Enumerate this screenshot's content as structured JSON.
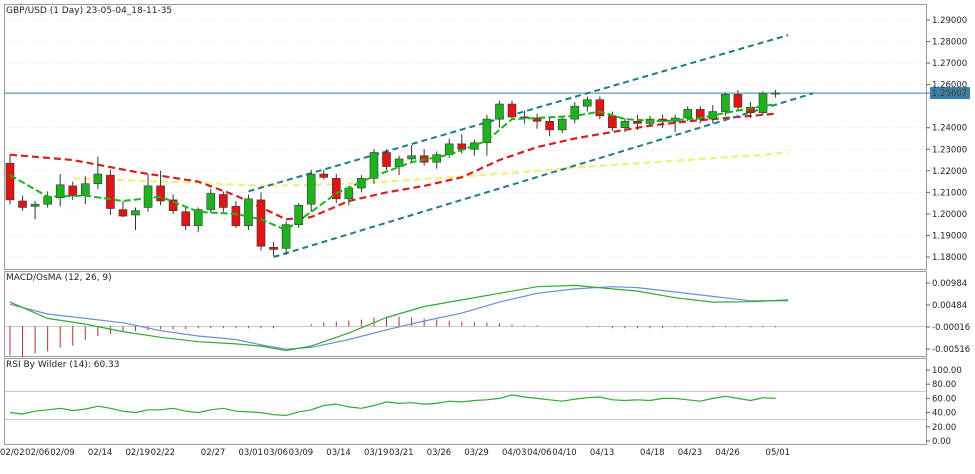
{
  "header": {
    "title": "GBP/USD (1 Day) 23-05-04_18-11-35",
    "macd_label": "MACD/OsMA (12, 26, 9)",
    "rsi_label": "RSI By Wilder (14): 60.33"
  },
  "colors": {
    "bull": "#1fb11f",
    "bear": "#e01515",
    "ma_fast": "#17b717",
    "ma_slow": "#d42020",
    "ma_long": "#f0f080",
    "channel": "#1e7c8a",
    "price_line": "#3a7fa8",
    "macd": "#6b8fd4",
    "signal": "#31a831",
    "osma": "#b03030",
    "rsi": "#31a831",
    "grid": "#c8c8c8"
  },
  "chart_data": [
    {
      "type": "candlestick",
      "title": "GBP/USD (1 Day) 23-05-04_18-11-35",
      "yticks": [
        "1.29000",
        "1.28000",
        "1.27000",
        "1.26000",
        "1.25607",
        "1.24000",
        "1.23000",
        "1.22000",
        "1.21000",
        "1.20000",
        "1.19000",
        "1.18000"
      ],
      "ylim": [
        1.175,
        1.292
      ],
      "current_price": 1.25607,
      "xticks": [
        "02/02",
        "02/06",
        "02/09",
        "02/14",
        "02/19",
        "02/22",
        "02/27",
        "03/01",
        "03/06",
        "03/09",
        "03/14",
        "03/19",
        "03/21",
        "03/26",
        "03/29",
        "04/03",
        "04/06",
        "04/10",
        "04/13",
        "04/18",
        "04/23",
        "04/26",
        "05/01"
      ],
      "candles": [
        {
          "o": 1.2235,
          "h": 1.2275,
          "l": 1.2045,
          "c": 1.2065
        },
        {
          "o": 1.206,
          "h": 1.2085,
          "l": 1.2015,
          "c": 1.203
        },
        {
          "o": 1.2035,
          "h": 1.206,
          "l": 1.1975,
          "c": 1.2045
        },
        {
          "o": 1.2045,
          "h": 1.2105,
          "l": 1.203,
          "c": 1.208
        },
        {
          "o": 1.2075,
          "h": 1.2185,
          "l": 1.2035,
          "c": 1.2135
        },
        {
          "o": 1.213,
          "h": 1.215,
          "l": 1.2065,
          "c": 1.2085
        },
        {
          "o": 1.2085,
          "h": 1.2175,
          "l": 1.2045,
          "c": 1.214
        },
        {
          "o": 1.214,
          "h": 1.2265,
          "l": 1.2115,
          "c": 1.2185
        },
        {
          "o": 1.218,
          "h": 1.2205,
          "l": 1.1995,
          "c": 1.2025
        },
        {
          "o": 1.202,
          "h": 1.206,
          "l": 1.1985,
          "c": 1.199
        },
        {
          "o": 1.1995,
          "h": 1.203,
          "l": 1.1925,
          "c": 1.2015
        },
        {
          "o": 1.203,
          "h": 1.2185,
          "l": 1.201,
          "c": 1.213
        },
        {
          "o": 1.213,
          "h": 1.22,
          "l": 1.204,
          "c": 1.206
        },
        {
          "o": 1.2065,
          "h": 1.209,
          "l": 1.2,
          "c": 1.2015
        },
        {
          "o": 1.201,
          "h": 1.203,
          "l": 1.1925,
          "c": 1.1945
        },
        {
          "o": 1.1945,
          "h": 1.203,
          "l": 1.1915,
          "c": 1.202
        },
        {
          "o": 1.202,
          "h": 1.2115,
          "l": 1.2005,
          "c": 1.2095
        },
        {
          "o": 1.209,
          "h": 1.2105,
          "l": 1.201,
          "c": 1.203
        },
        {
          "o": 1.2035,
          "h": 1.206,
          "l": 1.1935,
          "c": 1.1945
        },
        {
          "o": 1.1945,
          "h": 1.209,
          "l": 1.1925,
          "c": 1.207
        },
        {
          "o": 1.2065,
          "h": 1.21,
          "l": 1.183,
          "c": 1.185
        },
        {
          "o": 1.1845,
          "h": 1.187,
          "l": 1.1805,
          "c": 1.1835
        },
        {
          "o": 1.184,
          "h": 1.1965,
          "l": 1.181,
          "c": 1.195
        },
        {
          "o": 1.195,
          "h": 1.205,
          "l": 1.1935,
          "c": 1.204
        },
        {
          "o": 1.2045,
          "h": 1.2205,
          "l": 1.201,
          "c": 1.2185
        },
        {
          "o": 1.2185,
          "h": 1.2205,
          "l": 1.216,
          "c": 1.217
        },
        {
          "o": 1.2165,
          "h": 1.2185,
          "l": 1.205,
          "c": 1.207
        },
        {
          "o": 1.207,
          "h": 1.213,
          "l": 1.204,
          "c": 1.212
        },
        {
          "o": 1.212,
          "h": 1.218,
          "l": 1.21,
          "c": 1.2165
        },
        {
          "o": 1.2165,
          "h": 1.23,
          "l": 1.214,
          "c": 1.2285
        },
        {
          "o": 1.2285,
          "h": 1.23,
          "l": 1.2205,
          "c": 1.222
        },
        {
          "o": 1.222,
          "h": 1.227,
          "l": 1.218,
          "c": 1.2255
        },
        {
          "o": 1.2255,
          "h": 1.232,
          "l": 1.224,
          "c": 1.227
        },
        {
          "o": 1.227,
          "h": 1.23,
          "l": 1.2225,
          "c": 1.224
        },
        {
          "o": 1.224,
          "h": 1.229,
          "l": 1.221,
          "c": 1.2275
        },
        {
          "o": 1.2275,
          "h": 1.235,
          "l": 1.226,
          "c": 1.2325
        },
        {
          "o": 1.2325,
          "h": 1.237,
          "l": 1.228,
          "c": 1.23
        },
        {
          "o": 1.23,
          "h": 1.2345,
          "l": 1.227,
          "c": 1.233
        },
        {
          "o": 1.233,
          "h": 1.246,
          "l": 1.227,
          "c": 1.244
        },
        {
          "o": 1.244,
          "h": 1.2525,
          "l": 1.24,
          "c": 1.251
        },
        {
          "o": 1.251,
          "h": 1.2525,
          "l": 1.244,
          "c": 1.245
        },
        {
          "o": 1.245,
          "h": 1.248,
          "l": 1.242,
          "c": 1.2445
        },
        {
          "o": 1.2445,
          "h": 1.2465,
          "l": 1.2395,
          "c": 1.243
        },
        {
          "o": 1.243,
          "h": 1.2445,
          "l": 1.236,
          "c": 1.239
        },
        {
          "o": 1.239,
          "h": 1.245,
          "l": 1.2375,
          "c": 1.244
        },
        {
          "o": 1.244,
          "h": 1.252,
          "l": 1.242,
          "c": 1.25
        },
        {
          "o": 1.25,
          "h": 1.2545,
          "l": 1.2475,
          "c": 1.253
        },
        {
          "o": 1.253,
          "h": 1.2545,
          "l": 1.244,
          "c": 1.2455
        },
        {
          "o": 1.2455,
          "h": 1.2475,
          "l": 1.2385,
          "c": 1.24
        },
        {
          "o": 1.24,
          "h": 1.2445,
          "l": 1.238,
          "c": 1.243
        },
        {
          "o": 1.243,
          "h": 1.246,
          "l": 1.239,
          "c": 1.242
        },
        {
          "o": 1.242,
          "h": 1.2455,
          "l": 1.2405,
          "c": 1.244
        },
        {
          "o": 1.244,
          "h": 1.246,
          "l": 1.24,
          "c": 1.243
        },
        {
          "o": 1.243,
          "h": 1.246,
          "l": 1.238,
          "c": 1.2445
        },
        {
          "o": 1.2445,
          "h": 1.25,
          "l": 1.243,
          "c": 1.2485
        },
        {
          "o": 1.2485,
          "h": 1.25,
          "l": 1.242,
          "c": 1.244
        },
        {
          "o": 1.244,
          "h": 1.2505,
          "l": 1.242,
          "c": 1.2475
        },
        {
          "o": 1.2475,
          "h": 1.2565,
          "l": 1.2455,
          "c": 1.2555
        },
        {
          "o": 1.2555,
          "h": 1.2575,
          "l": 1.248,
          "c": 1.2495
        },
        {
          "o": 1.2495,
          "h": 1.252,
          "l": 1.2445,
          "c": 1.247
        },
        {
          "o": 1.247,
          "h": 1.257,
          "l": 1.246,
          "c": 1.256
        },
        {
          "o": 1.256,
          "h": 1.2575,
          "l": 1.254,
          "c": 1.2561
        }
      ],
      "ma_fast_points": [
        [
          0,
          1.218
        ],
        [
          3,
          1.208
        ],
        [
          6,
          1.2085
        ],
        [
          9,
          1.206
        ],
        [
          12,
          1.208
        ],
        [
          15,
          1.201
        ],
        [
          18,
          1.2
        ],
        [
          20,
          1.1975
        ],
        [
          22,
          1.1925
        ],
        [
          24,
          1.201
        ],
        [
          26,
          1.2095
        ],
        [
          29,
          1.2175
        ],
        [
          32,
          1.224
        ],
        [
          35,
          1.2275
        ],
        [
          38,
          1.234
        ],
        [
          40,
          1.244
        ],
        [
          42,
          1.2445
        ],
        [
          45,
          1.2455
        ],
        [
          47,
          1.2475
        ],
        [
          49,
          1.244
        ],
        [
          52,
          1.243
        ],
        [
          55,
          1.2445
        ],
        [
          58,
          1.248
        ],
        [
          61,
          1.251
        ]
      ],
      "ma_slow_points": [
        [
          0,
          1.2275
        ],
        [
          5,
          1.225
        ],
        [
          10,
          1.2195
        ],
        [
          15,
          1.215
        ],
        [
          18,
          1.2085
        ],
        [
          20,
          1.203
        ],
        [
          22,
          1.1975
        ],
        [
          24,
          1.1985
        ],
        [
          27,
          1.206
        ],
        [
          30,
          1.21
        ],
        [
          33,
          1.213
        ],
        [
          36,
          1.217
        ],
        [
          39,
          1.225
        ],
        [
          42,
          1.231
        ],
        [
          45,
          1.235
        ],
        [
          48,
          1.238
        ],
        [
          51,
          1.241
        ],
        [
          54,
          1.243
        ],
        [
          57,
          1.2445
        ],
        [
          60,
          1.246
        ],
        [
          61,
          1.2465
        ]
      ],
      "ma_long_points": [
        [
          5,
          1.2165
        ],
        [
          10,
          1.2155
        ],
        [
          15,
          1.2145
        ],
        [
          20,
          1.213
        ],
        [
          25,
          1.2135
        ],
        [
          30,
          1.215
        ],
        [
          35,
          1.217
        ],
        [
          40,
          1.219
        ],
        [
          45,
          1.2215
        ],
        [
          50,
          1.2235
        ],
        [
          55,
          1.2255
        ],
        [
          60,
          1.2275
        ],
        [
          62,
          1.2285
        ]
      ],
      "channel_upper": [
        [
          19,
          1.2105
        ],
        [
          62,
          1.283
        ]
      ],
      "channel_lower": [
        [
          21,
          1.18
        ],
        [
          64,
          1.256
        ]
      ]
    },
    {
      "type": "line",
      "title": "MACD/OsMA (12, 26, 9)",
      "yticks": [
        "0.00984",
        "0.00484",
        "-0.00016",
        "-0.00516"
      ],
      "ylim": [
        -0.0068,
        0.0105
      ],
      "macd_points": [
        [
          0,
          0.005
        ],
        [
          3,
          0.0028
        ],
        [
          6,
          0.0018
        ],
        [
          9,
          0.0008
        ],
        [
          12,
          -0.001
        ],
        [
          15,
          -0.0022
        ],
        [
          18,
          -0.003
        ],
        [
          20,
          -0.0042
        ],
        [
          22,
          -0.0052
        ],
        [
          24,
          -0.0048
        ],
        [
          27,
          -0.003
        ],
        [
          30,
          -0.0008
        ],
        [
          33,
          0.0012
        ],
        [
          36,
          0.003
        ],
        [
          39,
          0.0055
        ],
        [
          42,
          0.0075
        ],
        [
          45,
          0.0085
        ],
        [
          48,
          0.009
        ],
        [
          50,
          0.0088
        ],
        [
          53,
          0.0078
        ],
        [
          56,
          0.0068
        ],
        [
          59,
          0.0058
        ],
        [
          62,
          0.0058
        ]
      ],
      "signal_points": [
        [
          0,
          0.0055
        ],
        [
          3,
          0.0018
        ],
        [
          6,
          0.0005
        ],
        [
          9,
          -0.0012
        ],
        [
          12,
          -0.0025
        ],
        [
          15,
          -0.0035
        ],
        [
          18,
          -0.004
        ],
        [
          20,
          -0.0045
        ],
        [
          22,
          -0.0055
        ],
        [
          24,
          -0.0045
        ],
        [
          27,
          -0.0015
        ],
        [
          30,
          0.002
        ],
        [
          33,
          0.0045
        ],
        [
          36,
          0.006
        ],
        [
          39,
          0.0075
        ],
        [
          42,
          0.009
        ],
        [
          45,
          0.0093
        ],
        [
          48,
          0.0085
        ],
        [
          50,
          0.008
        ],
        [
          53,
          0.0065
        ],
        [
          56,
          0.0055
        ],
        [
          59,
          0.0056
        ],
        [
          62,
          0.006
        ]
      ],
      "osma": [
        -0.003,
        -0.0032,
        -0.0028,
        -0.0026,
        -0.0022,
        -0.002,
        -0.0014,
        -0.001,
        -0.0008,
        -0.0006,
        -0.0005,
        -0.0004,
        -0.0003,
        -0.0003,
        -0.0003,
        -0.0002,
        -0.0002,
        -0.0002,
        -0.0002,
        -0.0002,
        -0.0002,
        -0.0002,
        0,
        0,
        0.0002,
        0.0004,
        0.0005,
        0.0006,
        0.0007,
        0.0009,
        0.001,
        0.001,
        0.0009,
        0.0008,
        0.0007,
        0.0006,
        0.0005,
        0.0004,
        0.0004,
        0.0003,
        0.0002,
        0.0001,
        0.0001,
        0,
        0,
        0,
        -0.0001,
        -0.0001,
        -0.0002,
        -0.0002,
        -0.0002,
        -0.0002,
        -0.0002,
        -0.0001,
        -0.0001,
        -0.0001,
        -0.0001,
        -0.0001,
        -0.0001,
        -0.0001,
        -0.0001,
        -0.0001
      ]
    },
    {
      "type": "line",
      "title": "RSI By Wilder (14): 60.33",
      "yticks": [
        "100.00",
        "80.00",
        "60.00",
        "40.00",
        "20.00",
        "0.00"
      ],
      "ylim": [
        0,
        100
      ],
      "levels": [
        70,
        30
      ],
      "values": [
        40,
        38,
        42,
        44,
        46,
        43,
        45,
        49,
        46,
        42,
        40,
        44,
        44,
        46,
        42,
        40,
        44,
        46,
        42,
        41,
        40,
        37,
        36,
        41,
        44,
        50,
        52,
        48,
        46,
        50,
        55,
        53,
        54,
        52,
        53,
        56,
        55,
        57,
        58,
        60,
        65,
        62,
        60,
        58,
        56,
        59,
        61,
        62,
        58,
        57,
        58,
        57,
        60,
        60,
        58,
        56,
        60,
        63,
        60,
        57,
        61,
        60
      ]
    }
  ]
}
